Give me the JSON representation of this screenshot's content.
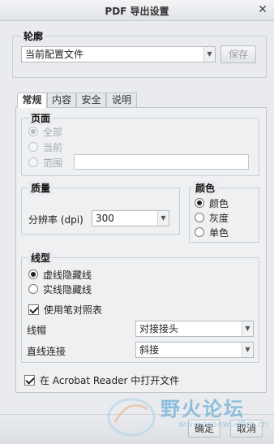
{
  "dialog": {
    "title": "PDF 导出设置",
    "close_glyph": "✕"
  },
  "profile": {
    "legend": "轮廓",
    "selected": "当前配置文件",
    "save_label": "保存"
  },
  "tabs": [
    {
      "label": "常规",
      "active": true
    },
    {
      "label": "内容",
      "active": false
    },
    {
      "label": "安全",
      "active": false
    },
    {
      "label": "说明",
      "active": false
    }
  ],
  "pages": {
    "legend": "页面",
    "options": [
      "全部",
      "当前",
      "范围"
    ],
    "selected": "全部",
    "range_value": ""
  },
  "quality": {
    "legend": "质量",
    "resolution_label": "分辨率 (dpi)",
    "resolution_value": "300"
  },
  "color": {
    "legend": "颜色",
    "options": [
      "颜色",
      "灰度",
      "单色"
    ],
    "selected": "颜色"
  },
  "linetype": {
    "legend": "线型",
    "options": [
      "虚线隐藏线",
      "实线隐藏线"
    ],
    "selected": "虚线隐藏线",
    "pen_table_label": "使用笔对照表",
    "pen_table_checked": true,
    "cap_label": "线帽",
    "cap_value": "对接接头",
    "join_label": "直线连接",
    "join_value": "斜接"
  },
  "open_in_reader": {
    "label": "在 Acrobat Reader 中打开文件",
    "checked": true
  },
  "footer": {
    "ok_label": "确定",
    "cancel_label": "取消"
  },
  "watermark": {
    "text": "野火论坛",
    "sub": "www.proewildfire.cn"
  },
  "icons": {
    "close": "close-icon",
    "dropdown": "chevron-down-icon"
  }
}
